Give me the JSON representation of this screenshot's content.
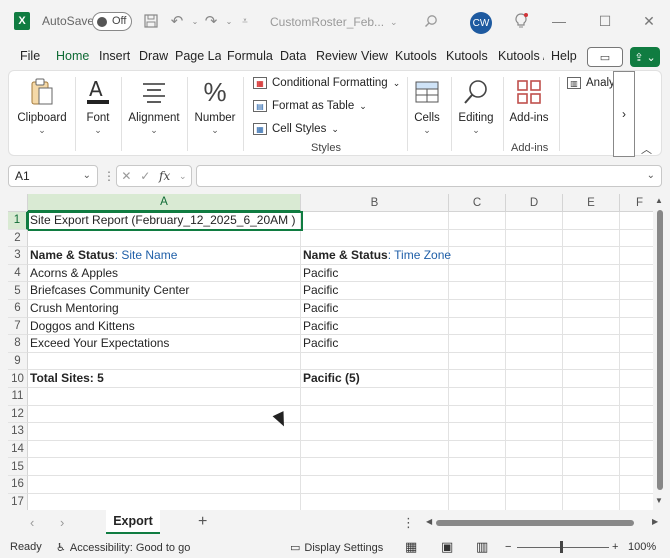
{
  "titlebar": {
    "app_logo": "X",
    "autosave_label": "AutoSave",
    "autosave_state": "Off",
    "filename": "CustomRoster_Feb...",
    "avatar": "CW",
    "icons": [
      "save-icon",
      "undo-icon",
      "redo-icon",
      "customize-icon",
      "search-icon",
      "lightbulb-icon",
      "minimize-icon",
      "maximize-icon",
      "close-icon"
    ]
  },
  "menu": {
    "tabs": [
      "File",
      "Home",
      "Insert",
      "Draw",
      "Page Lay",
      "Formulas",
      "Data",
      "Review",
      "View",
      "Kutools ",
      "Kutools I",
      "Kutools /",
      "Help"
    ],
    "active_tab": "Home"
  },
  "ribbon": {
    "clipboard": "Clipboard",
    "font": "Font",
    "alignment": "Alignment",
    "number": "Number",
    "conditional_formatting": "Conditional Formatting",
    "format_as_table": "Format as Table",
    "cell_styles": "Cell Styles",
    "styles_caption": "Styles",
    "cells": "Cells",
    "editing": "Editing",
    "addins": "Add-ins",
    "addins_caption": "Add-ins",
    "analyze": "Analy",
    "more": "›"
  },
  "formula_bar": {
    "name_box": "A1",
    "fx": "fx",
    "value": ""
  },
  "grid": {
    "columns": [
      "A",
      "B",
      "C",
      "D",
      "E",
      "F"
    ],
    "rows": [
      "1",
      "2",
      "3",
      "4",
      "5",
      "6",
      "7",
      "8",
      "9",
      "10",
      "11",
      "12",
      "13",
      "14",
      "15",
      "16",
      "17"
    ],
    "cells": {
      "a1": "Site Export Report (February_12_2025_6_20AM )",
      "a3_bold": "Name & Status",
      "a3_accent": ": Site Name",
      "b3_bold": "Name & Status",
      "b3_accent": ": Time Zone",
      "a4": "Acorns & Apples",
      "a5": "Briefcases Community Center",
      "a6": "Crush Mentoring",
      "a7": "Doggos and Kittens",
      "a8": "Exceed Your Expectations",
      "b4": "Pacific",
      "b5": "Pacific",
      "b6": "Pacific",
      "b7": "Pacific",
      "b8": "Pacific",
      "a10": "Total Sites: 5",
      "b10": "Pacific (5)"
    }
  },
  "sheets": {
    "active": "Export",
    "add": "+"
  },
  "status": {
    "ready": "Ready",
    "accessibility": "Accessibility: Good to go",
    "display_settings": "Display Settings",
    "zoom": "100%"
  },
  "colors": {
    "accent": "#107c41",
    "link_blue": "#1f5fa8"
  }
}
